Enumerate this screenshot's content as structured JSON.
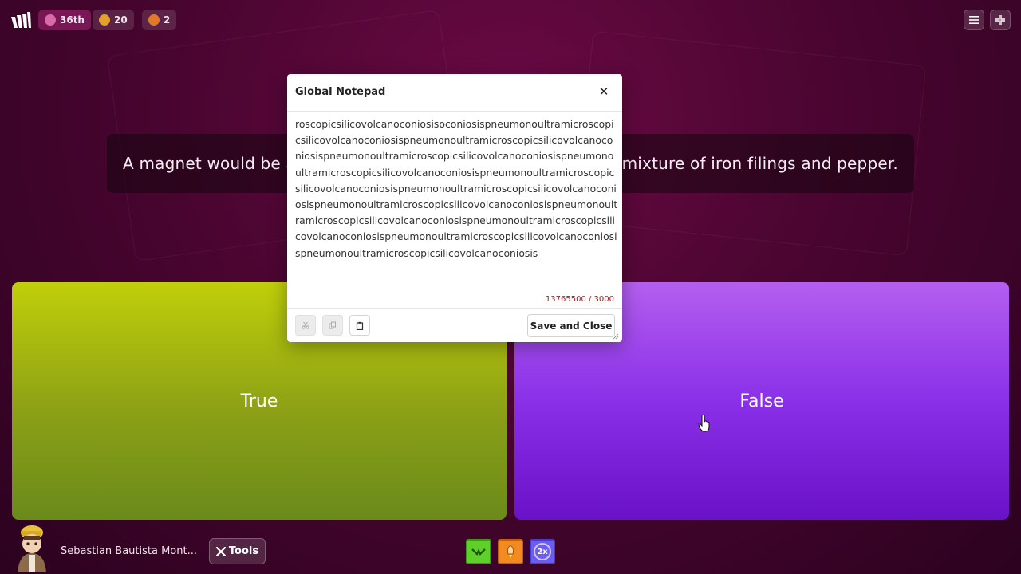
{
  "topbar": {
    "rank": "36th",
    "coins": "20",
    "drops": "2",
    "menu_icon": "hamburger-icon",
    "collapse_icon": "collapse-icon"
  },
  "question": {
    "text_left": "A magnet would be a",
    "text_right": "a mixture of iron filings and pepper."
  },
  "answers": {
    "true_label": "True",
    "false_label": "False"
  },
  "notepad": {
    "title": "Global Notepad",
    "content": "roscopicsilicovolcanoconiosisoconiosispneumonoultramicroscopicsilicovolcanoconiosispneumonoultramicroscopicsilicovolcanoconiosispneumonoultramicroscopicsilicovolcanoconiosispneumonoultramicroscopicsilicovolcanoconiosispneumonoultramicroscopicsilicovolcanoconiosispneumonoultramicroscopicsilicovolcanoconiosispneumonoultramicroscopicsilicovolcanoconiosispneumonoultramicroscopicsilicovolcanoconiosispneumonoultramicroscopicsilicovolcanoconiosispneumonoultramicroscopicsilicovolcanoconiosispneumonoultramicroscopicsilicovolcanoconiosis",
    "counter": "13765500 / 3000",
    "save_label": "Save and Close",
    "counter_color": "#b0141b"
  },
  "player": {
    "name": "Sebastian Bautista Mont...",
    "tools_label": "Tools"
  },
  "powerups": [
    "double-icon",
    "rocket-icon",
    "2x-icon"
  ],
  "powerup_text": "2x",
  "colors": {
    "true": "#9fb512",
    "false": "#8a30e8",
    "background": "#4a0530"
  }
}
